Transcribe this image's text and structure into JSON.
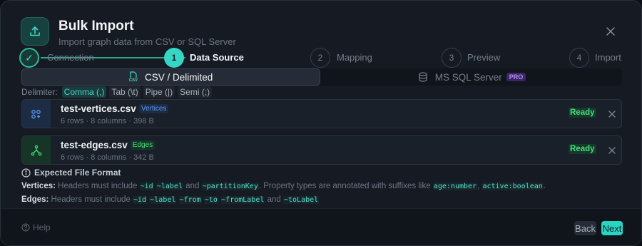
{
  "header": {
    "title": "Bulk Import",
    "subtitle": "Import graph data from CSV or SQL Server",
    "icon": "upload-icon"
  },
  "steps": [
    {
      "number": "",
      "label": "Connection",
      "state": "complete"
    },
    {
      "number": "1",
      "label": "Data Source",
      "state": "active"
    },
    {
      "number": "2",
      "label": "Mapping",
      "state": "pending"
    },
    {
      "number": "3",
      "label": "Preview",
      "state": "pending"
    },
    {
      "number": "4",
      "label": "Import",
      "state": "pending"
    }
  ],
  "source_tabs": {
    "csv_label": "CSV / Delimited",
    "csv_icon_text": "CSV",
    "sql_label": "MS SQL Server",
    "sql_badge": "PRO"
  },
  "delimiter": {
    "label": "Delimiter:",
    "options": [
      "Comma (,)",
      "Tab (\\t)",
      "Pipe (|)",
      "Semi (;)"
    ],
    "selected": "Comma (,)"
  },
  "files": [
    {
      "name": "test-vertices.csv",
      "badge": "Vertices",
      "meta": "6 rows · 8 columns · 398 B",
      "status": "Ready",
      "color": "#4f8ff0"
    },
    {
      "name": "test-edges.csv",
      "badge": "Edges",
      "meta": "6 rows · 8 columns · 342 B",
      "status": "Ready",
      "color": "#3ee07f"
    }
  ],
  "format": {
    "title": "Expected File Format",
    "vertices_label": "Vertices:",
    "vertices_text_1": "Headers must include",
    "vertices_codes": [
      "~id",
      "~label"
    ],
    "vertices_text_2": "and",
    "vertices_code_3": "~partitionKey",
    "vertices_text_3": ". Property types are annotated with suffixes like",
    "vertices_type_codes": [
      "age:number",
      "active:boolean"
    ],
    "edges_label": "Edges:",
    "edges_text_1": "Headers must include",
    "edges_codes": [
      "~id",
      "~label",
      "~from",
      "~to",
      "~fromLabel"
    ],
    "edges_text_2": "and",
    "edges_code_last": "~toLabel"
  },
  "footer": {
    "help_label": "Help",
    "back_label": "Back",
    "next_label": "Next"
  },
  "colors": {
    "accent": "#2ad4c4",
    "ready": "#3ee07f",
    "pro": "#b28cf5"
  }
}
